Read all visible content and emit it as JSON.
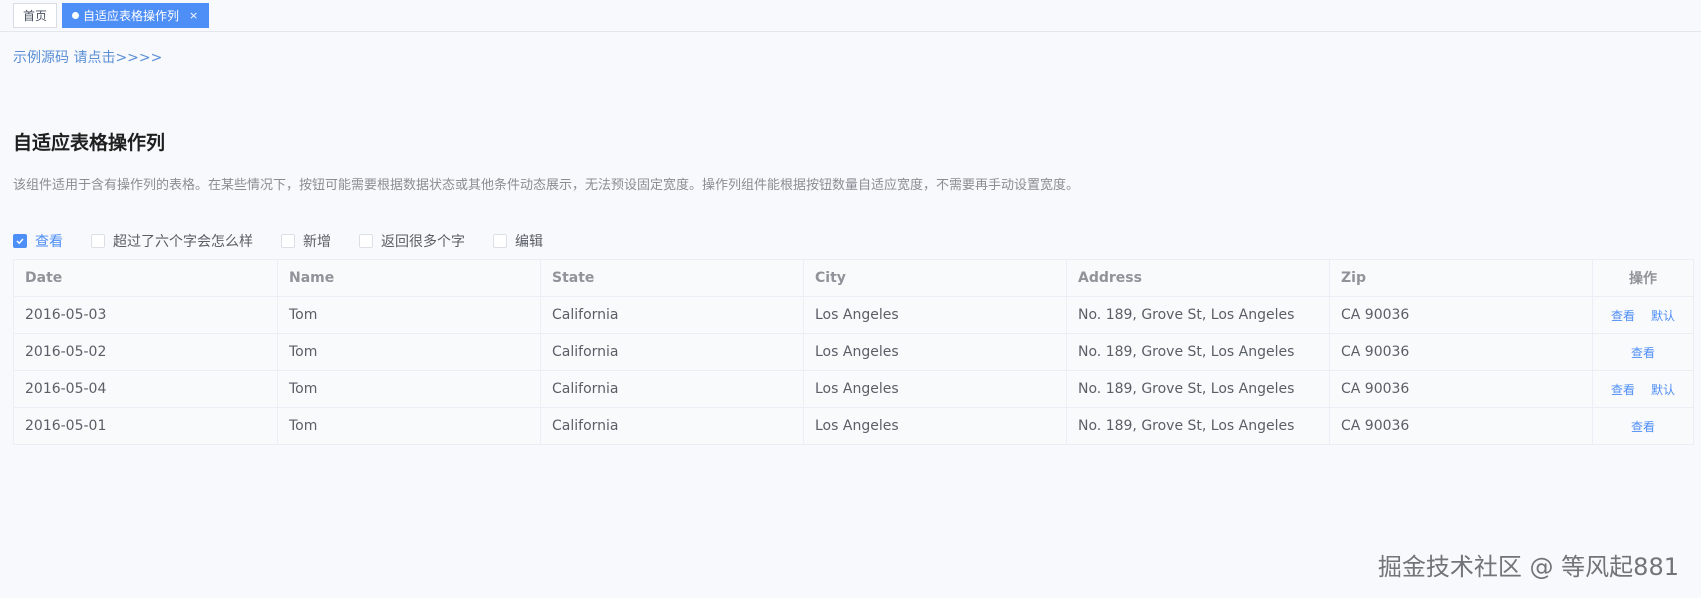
{
  "tabs": [
    {
      "label": "首页",
      "active": false
    },
    {
      "label": "自适应表格操作列",
      "active": true,
      "close": "×"
    }
  ],
  "source_link": "示例源码 请点击>>>>",
  "title": "自适应表格操作列",
  "description": "该组件适用于含有操作列的表格。在某些情况下，按钮可能需要根据数据状态或其他条件动态展示，无法预设固定宽度。操作列组件能根据按钮数量自适应宽度，不需要再手动设置宽度。",
  "filters": [
    {
      "label": "查看",
      "checked": true
    },
    {
      "label": "超过了六个字会怎么样",
      "checked": false
    },
    {
      "label": "新增",
      "checked": false
    },
    {
      "label": "返回很多个字",
      "checked": false
    },
    {
      "label": "编辑",
      "checked": false
    }
  ],
  "table": {
    "headers": [
      "Date",
      "Name",
      "State",
      "City",
      "Address",
      "Zip",
      "操作"
    ],
    "rows": [
      {
        "date": "2016-05-03",
        "name": "Tom",
        "state": "California",
        "city": "Los Angeles",
        "address": "No. 189, Grove St, Los Angeles",
        "zip": "CA 90036",
        "actions": [
          "查看",
          "默认"
        ]
      },
      {
        "date": "2016-05-02",
        "name": "Tom",
        "state": "California",
        "city": "Los Angeles",
        "address": "No. 189, Grove St, Los Angeles",
        "zip": "CA 90036",
        "actions": [
          "查看"
        ]
      },
      {
        "date": "2016-05-04",
        "name": "Tom",
        "state": "California",
        "city": "Los Angeles",
        "address": "No. 189, Grove St, Los Angeles",
        "zip": "CA 90036",
        "actions": [
          "查看",
          "默认"
        ]
      },
      {
        "date": "2016-05-01",
        "name": "Tom",
        "state": "California",
        "city": "Los Angeles",
        "address": "No. 189, Grove St, Los Angeles",
        "zip": "CA 90036",
        "actions": [
          "查看"
        ]
      }
    ]
  },
  "watermark": "掘金技术社区 @ 等风起881",
  "colors": {
    "accent": "#4e8ef7",
    "background": "#f7f9fc"
  }
}
